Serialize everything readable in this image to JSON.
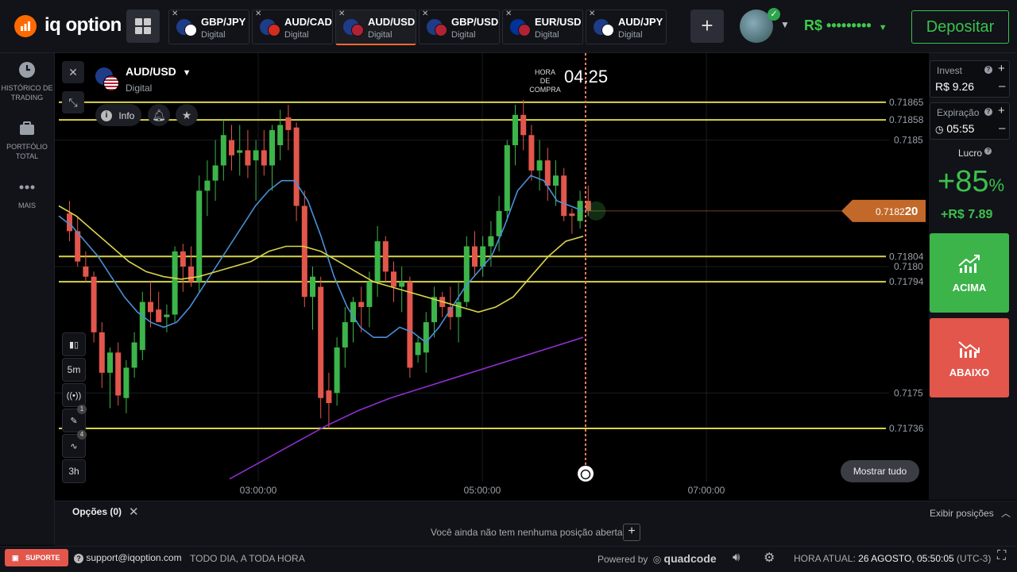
{
  "brand": {
    "name": "iq option",
    "accent": "#ff6a00"
  },
  "tabs": [
    {
      "pair": "GBP/JPY",
      "type": "Digital",
      "flags": [
        "#1f3c88",
        "#ffffff"
      ],
      "active": false
    },
    {
      "pair": "AUD/CAD",
      "type": "Digital",
      "flags": [
        "#1f3c88",
        "#d52b1e"
      ],
      "active": false
    },
    {
      "pair": "AUD/USD",
      "type": "Digital",
      "flags": [
        "#1f3c88",
        "#b22234"
      ],
      "active": true
    },
    {
      "pair": "GBP/USD",
      "type": "Digital",
      "flags": [
        "#1f3c88",
        "#b22234"
      ],
      "active": false
    },
    {
      "pair": "EUR/USD",
      "type": "Digital",
      "flags": [
        "#003399",
        "#b22234"
      ],
      "active": false
    },
    {
      "pair": "AUD/JPY",
      "type": "Digital",
      "flags": [
        "#1f3c88",
        "#ffffff"
      ],
      "active": false
    }
  ],
  "header": {
    "balance": "R$ •••••••••",
    "deposit_label": "Depositar"
  },
  "sidebar": [
    {
      "label": "HISTÓRICO DE TRADING",
      "icon": "clock-icon"
    },
    {
      "label": "PORTFÓLIO TOTAL",
      "icon": "briefcase-icon"
    },
    {
      "label": "MAIS",
      "icon": "more-dots-icon"
    }
  ],
  "asset": {
    "pair": "AUD/USD",
    "type": "Digital",
    "info_label": "Info"
  },
  "timer": {
    "label": "HORA DE COMPRA",
    "time": "04:25"
  },
  "toolbar": [
    {
      "label": "",
      "icon": "candles-icon"
    },
    {
      "label": "5m",
      "icon": ""
    },
    {
      "label": "",
      "icon": "signal-icon"
    },
    {
      "label": "",
      "icon": "pencil-icon",
      "badge": "1"
    },
    {
      "label": "",
      "icon": "indicator-icon",
      "badge": "4"
    },
    {
      "label": "3h",
      "icon": ""
    }
  ],
  "mostrar_label": "Mostrar tudo",
  "trade": {
    "invest_label": "Invest",
    "invest_value": "R$ 9.26",
    "expiry_label": "Expiração",
    "expiry_value": "05:55",
    "profit_label": "Lucro",
    "profit_pct": "+85",
    "profit_pct_sign": "%",
    "profit_amount": "+R$ 7.89",
    "up_label": "ACIMA",
    "down_label": "ABAIXO",
    "up_color": "#3cb44a",
    "down_color": "#e2564b"
  },
  "chart_data": {
    "type": "candlestick",
    "x_ticks": [
      "03:00:00",
      "05:00:00",
      "07:00:00"
    ],
    "y_ticks": [
      "0.7185",
      "0.7180",
      "0.7175"
    ],
    "ylim": [
      0.71725,
      0.71875
    ],
    "horizontal_levels": [
      {
        "value": 0.71865,
        "label": "0.71865",
        "color": "#d8d44a"
      },
      {
        "value": 0.71858,
        "label": "0.71858",
        "color": "#d8d44a"
      },
      {
        "value": 0.71804,
        "label": "0.71804",
        "color": "#d8d44a"
      },
      {
        "value": 0.71794,
        "label": "0.71794",
        "color": "#d8d44a"
      },
      {
        "value": 0.71736,
        "label": "0.71736",
        "color": "#d8d44a"
      }
    ],
    "current_price": {
      "value": 0.71822,
      "label_main": "0.7182",
      "label_bold": "20",
      "color": "#c2692a"
    },
    "candles": [
      [
        0.71821,
        0.71826,
        0.7181,
        0.71814
      ],
      [
        0.71814,
        0.7182,
        0.718,
        0.71802
      ],
      [
        0.718,
        0.71806,
        0.71794,
        0.71796
      ],
      [
        0.71796,
        0.71798,
        0.7177,
        0.71774
      ],
      [
        0.71774,
        0.71778,
        0.71752,
        0.71758
      ],
      [
        0.71758,
        0.71768,
        0.71744,
        0.71766
      ],
      [
        0.71766,
        0.7177,
        0.71745,
        0.71749
      ],
      [
        0.71748,
        0.71763,
        0.71742,
        0.7176
      ],
      [
        0.7176,
        0.71774,
        0.71756,
        0.7177
      ],
      [
        0.71767,
        0.7179,
        0.71763,
        0.71786
      ],
      [
        0.71786,
        0.71794,
        0.71776,
        0.71782
      ],
      [
        0.71783,
        0.7179,
        0.71778,
        0.71778
      ],
      [
        0.7178,
        0.71785,
        0.71774,
        0.71781
      ],
      [
        0.71781,
        0.71808,
        0.71778,
        0.71806
      ],
      [
        0.71806,
        0.71809,
        0.7179,
        0.718
      ],
      [
        0.718,
        0.71808,
        0.71792,
        0.71794
      ],
      [
        0.71794,
        0.71836,
        0.7179,
        0.7183
      ],
      [
        0.7183,
        0.71842,
        0.7182,
        0.71834
      ],
      [
        0.71834,
        0.7185,
        0.71826,
        0.7184
      ],
      [
        0.7184,
        0.71858,
        0.71834,
        0.71852
      ],
      [
        0.7185,
        0.71856,
        0.71838,
        0.71844
      ],
      [
        0.71845,
        0.71856,
        0.71836,
        0.71846
      ],
      [
        0.71846,
        0.71854,
        0.71835,
        0.7184
      ],
      [
        0.71842,
        0.7185,
        0.71826,
        0.71846
      ],
      [
        0.71846,
        0.71854,
        0.71836,
        0.7184
      ],
      [
        0.7184,
        0.71856,
        0.7183,
        0.71854
      ],
      [
        0.71848,
        0.71862,
        0.71842,
        0.71856
      ],
      [
        0.71859,
        0.71864,
        0.71846,
        0.71854
      ],
      [
        0.71855,
        0.71857,
        0.71818,
        0.71824
      ],
      [
        0.71824,
        0.7183,
        0.71784,
        0.71788
      ],
      [
        0.71788,
        0.718,
        0.71775,
        0.71796
      ],
      [
        0.71792,
        0.71796,
        0.7174,
        0.71748
      ],
      [
        0.71751,
        0.71758,
        0.71736,
        0.71746
      ],
      [
        0.7175,
        0.71772,
        0.71745,
        0.71768
      ],
      [
        0.71768,
        0.71784,
        0.7176,
        0.71778
      ],
      [
        0.71778,
        0.71788,
        0.7177,
        0.71786
      ],
      [
        0.71786,
        0.71792,
        0.71774,
        0.71784
      ],
      [
        0.71784,
        0.71798,
        0.71776,
        0.71794
      ],
      [
        0.71794,
        0.71816,
        0.71788,
        0.7181
      ],
      [
        0.7181,
        0.71812,
        0.71794,
        0.71798
      ],
      [
        0.71798,
        0.71802,
        0.71786,
        0.71792
      ],
      [
        0.71792,
        0.718,
        0.71782,
        0.71794
      ],
      [
        0.71794,
        0.71796,
        0.71756,
        0.7176
      ],
      [
        0.71765,
        0.71772,
        0.71762,
        0.7177
      ],
      [
        0.71766,
        0.71782,
        0.71758,
        0.71778
      ],
      [
        0.71778,
        0.71792,
        0.71772,
        0.71788
      ],
      [
        0.71788,
        0.7179,
        0.7178,
        0.71784
      ],
      [
        0.71784,
        0.71792,
        0.71775,
        0.7178
      ],
      [
        0.7178,
        0.71794,
        0.7177,
        0.71786
      ],
      [
        0.71786,
        0.71812,
        0.71784,
        0.71808
      ],
      [
        0.71808,
        0.71814,
        0.71796,
        0.718
      ],
      [
        0.718,
        0.71812,
        0.71796,
        0.71808
      ],
      [
        0.71808,
        0.71818,
        0.718,
        0.71812
      ],
      [
        0.71812,
        0.71828,
        0.71806,
        0.71822
      ],
      [
        0.71822,
        0.7185,
        0.71818,
        0.71848
      ],
      [
        0.71848,
        0.71864,
        0.7184,
        0.7186
      ],
      [
        0.7186,
        0.71866,
        0.71846,
        0.71852
      ],
      [
        0.71852,
        0.71856,
        0.71834,
        0.71838
      ],
      [
        0.71838,
        0.7185,
        0.7183,
        0.71842
      ],
      [
        0.71842,
        0.71847,
        0.71826,
        0.71832
      ],
      [
        0.71832,
        0.71842,
        0.71824,
        0.71836
      ],
      [
        0.71836,
        0.71839,
        0.71818,
        0.7182
      ],
      [
        0.71821,
        0.71823,
        0.71813,
        0.7182
      ],
      [
        0.71818,
        0.7183,
        0.71815,
        0.71826
      ],
      [
        0.71826,
        0.71832,
        0.7182,
        0.71822
      ]
    ],
    "moving_averages": [
      {
        "color": "#4a90d9",
        "values": [
          0.7182,
          0.71816,
          0.7181,
          0.71804,
          0.71796,
          0.71788,
          0.71782,
          0.71778,
          0.71776,
          0.71778,
          0.71784,
          0.71792,
          0.718,
          0.71808,
          0.71816,
          0.71824,
          0.7183,
          0.71834,
          0.71834,
          0.71826,
          0.71812,
          0.71796,
          0.71784,
          0.71776,
          0.71772,
          0.71772,
          0.71776,
          0.71774,
          0.7177,
          0.71776,
          0.71784,
          0.71792,
          0.71798,
          0.71804,
          0.71816,
          0.7183,
          0.71836,
          0.71834,
          0.71826,
          0.71824,
          0.71822
        ]
      },
      {
        "color": "#d8d44a",
        "values": [
          0.71824,
          0.7182,
          0.71814,
          0.71808,
          0.71802,
          0.71798,
          0.71796,
          0.71795,
          0.71796,
          0.71798,
          0.718,
          0.71802,
          0.71806,
          0.71808,
          0.71808,
          0.71806,
          0.71802,
          0.71798,
          0.71794,
          0.71792,
          0.7179,
          0.71788,
          0.71786,
          0.71784,
          0.71782,
          0.71784,
          0.71788,
          0.71796,
          0.71804,
          0.7181,
          0.71812
        ]
      },
      {
        "color": "#8e2fd0",
        "values": [
          0.71716,
          0.71723,
          0.7173,
          0.71737,
          0.71743,
          0.71748,
          0.71752,
          0.71756,
          0.7176,
          0.71764,
          0.71768,
          0.71772
        ]
      }
    ]
  },
  "bottom": {
    "options_label": "Opções",
    "options_count": "(0)",
    "exibir_label": "Exibir posições",
    "no_positions": "Você ainda não tem nenhuma posição aberta"
  },
  "footer": {
    "support_label": "SUPORTE",
    "email": "support@iqoption.com",
    "hours": "TODO DIA, A TODA HORA",
    "powered": "Powered by",
    "powered_brand": "quadcode",
    "time_label": "HORA ATUAL:",
    "time_value": "26 AGOSTO, 05:50:05",
    "tz": "(UTC-3)"
  }
}
